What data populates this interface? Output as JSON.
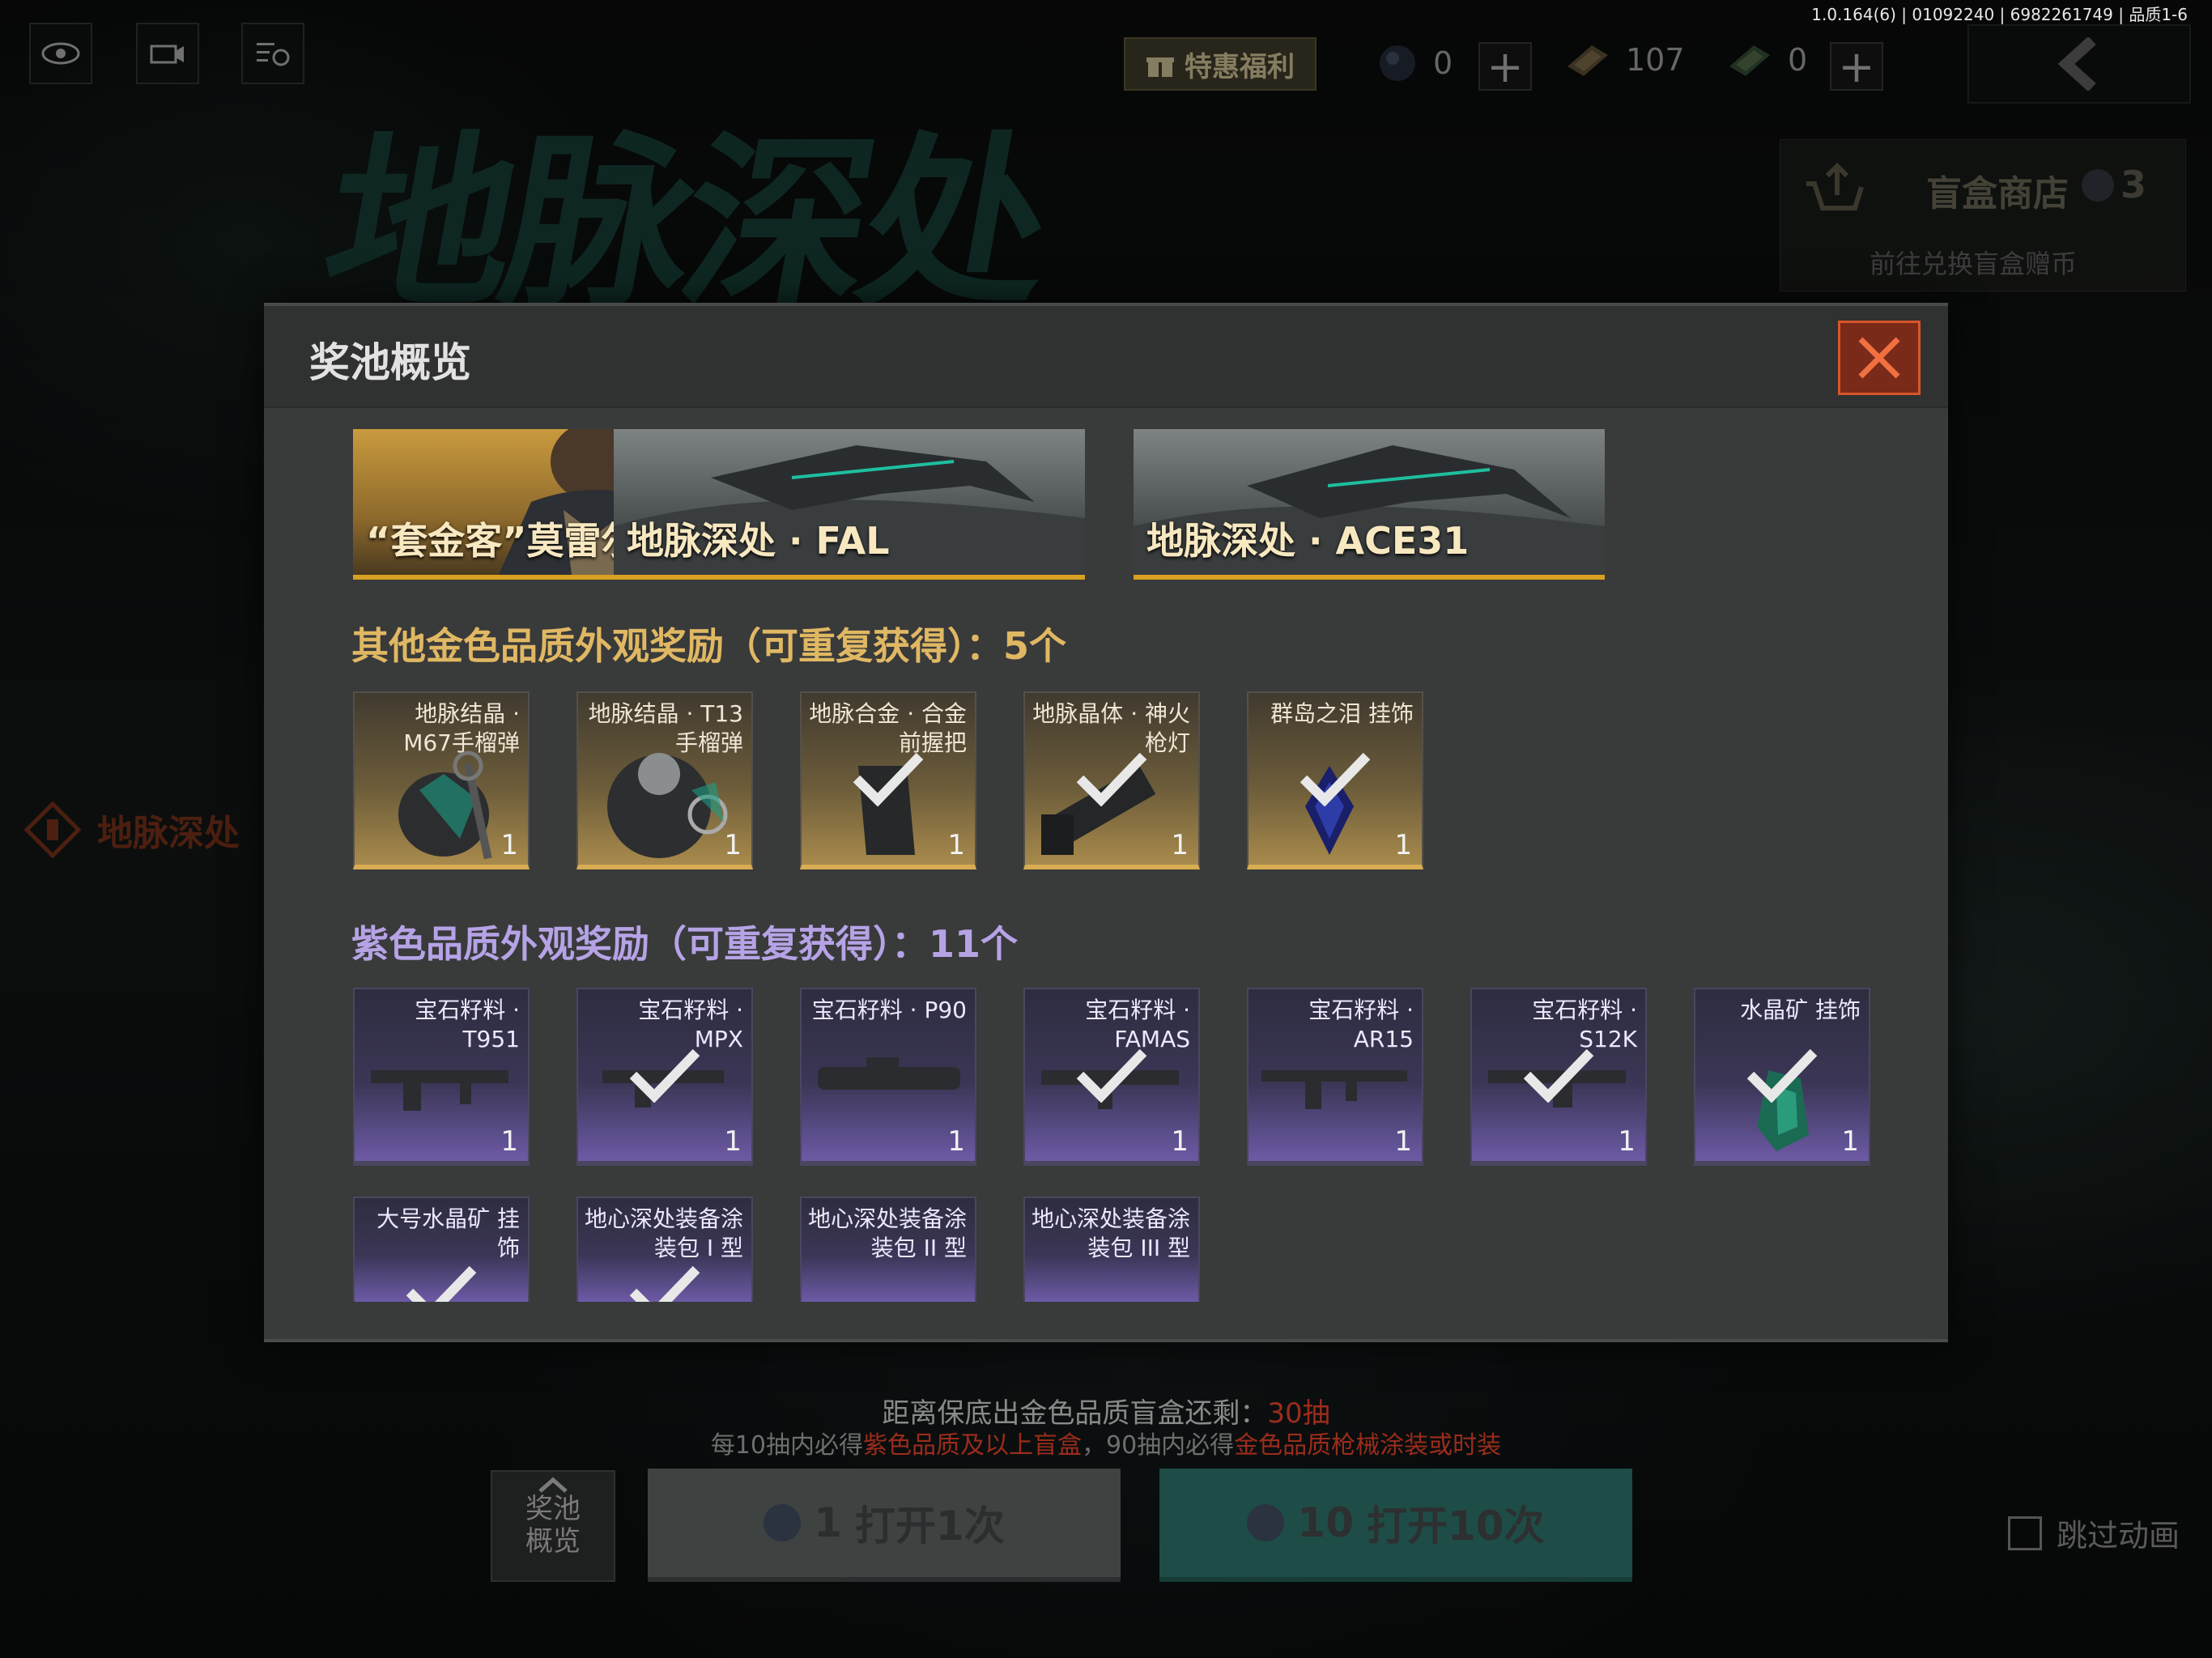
{
  "version": "1.0.164(6) | 01092240 | 6982261749 | 品质1-6",
  "top_icons": [
    "eye-icon",
    "camera-icon",
    "list-clock-icon"
  ],
  "welfare_label": "特惠福利",
  "currencies": [
    {
      "icon": "gem-icon",
      "value": "0"
    },
    {
      "icon": "ticket-icon",
      "value": "107"
    },
    {
      "icon": "card-icon",
      "value": "0"
    }
  ],
  "game_title": "地脉深处",
  "shop": {
    "title": "盲盒商店",
    "count": "3",
    "subtitle": "前往兑换盲盒赠币"
  },
  "side_label": "地脉深处",
  "modal": {
    "title": "奖池概览",
    "banners": [
      {
        "label": "“套金客”莫雷尔"
      },
      {
        "label": "地脉深处 · FAL"
      },
      {
        "label": "地脉深处 · ACE31"
      }
    ],
    "gold_section_title": "其他金色品质外观奖励（可重复获得）：5个",
    "gold_items": [
      {
        "name": "地脉结晶 · M67手榴弹",
        "count": "1",
        "owned": false
      },
      {
        "name": "地脉结晶 · T13手榴弹",
        "count": "1",
        "owned": false
      },
      {
        "name": "地脉合金 · 合金前握把",
        "count": "1",
        "owned": true
      },
      {
        "name": "地脉晶体 · 神火枪灯",
        "count": "1",
        "owned": true
      },
      {
        "name": "群岛之泪 挂饰",
        "count": "1",
        "owned": true
      }
    ],
    "purple_section_title": "紫色品质外观奖励（可重复获得）：11个",
    "purple_items": [
      {
        "name": "宝石籽料 · T951",
        "count": "1",
        "owned": false
      },
      {
        "name": "宝石籽料 · MPX",
        "count": "1",
        "owned": true
      },
      {
        "name": "宝石籽料 · P90",
        "count": "1",
        "owned": false
      },
      {
        "name": "宝石籽料 · FAMAS",
        "count": "1",
        "owned": true
      },
      {
        "name": "宝石籽料 · AR15",
        "count": "1",
        "owned": false
      },
      {
        "name": "宝石籽料 · S12K",
        "count": "1",
        "owned": true
      },
      {
        "name": "水晶矿 挂饰",
        "count": "1",
        "owned": true
      }
    ],
    "purple_items_row2": [
      {
        "name": "大号水晶矿 挂饰",
        "owned": true
      },
      {
        "name": "地心深处装备涂装包 I 型",
        "owned": true
      },
      {
        "name": "地心深处装备涂装包 II 型",
        "owned": false
      },
      {
        "name": "地心深处装备涂装包 III 型",
        "owned": false
      }
    ]
  },
  "guarantee": {
    "prefix": "距离保底出金色品质盲盒还剩：",
    "value": "30抽"
  },
  "rule": {
    "part1": "每10抽内必得",
    "red1": "紫色品质及以上盲盒",
    "part2": "，90抽内必得",
    "red2": "金色品质枪械涂装或时装"
  },
  "pool_button": {
    "line1": "奖池",
    "line2": "概览"
  },
  "open_once": {
    "cost": "1",
    "label": "打开1次"
  },
  "open_ten": {
    "cost": "10",
    "label": "打开10次"
  },
  "skip_label": "跳过动画",
  "colors": {
    "gold": "#d7ac52",
    "purple": "#a88cf0",
    "close": "#d8552c",
    "danger_text": "#9b2c1c"
  }
}
